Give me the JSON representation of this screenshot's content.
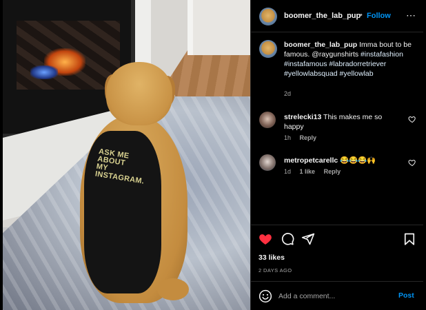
{
  "post": {
    "username": "boomer_the_lab_pup",
    "follow_label": "Follow",
    "separator": "•",
    "more_icon": "more-horizontal-icon",
    "photo": {
      "shirt_text": "ASK ME\nABOUT\nMY\nINSTAGRAM."
    }
  },
  "caption": {
    "username": "boomer_the_lab_pup",
    "text": "Imma bout to be famous. @raygunshirts",
    "hashtags": "#instafashion #instafamous #labradorretriever #yellowlabsquad #yellowlab",
    "time": "2d"
  },
  "comments": [
    {
      "username": "strelecki13",
      "text": "This makes me so happy",
      "time": "1h",
      "likes": "",
      "reply_label": "Reply"
    },
    {
      "username": "metropetcarellc",
      "text": "😂😂😂🙌",
      "time": "1d",
      "likes": "1 like",
      "reply_label": "Reply"
    }
  ],
  "actions": {
    "like_icon": "heart-filled-icon",
    "comment_icon": "comment-icon",
    "share_icon": "share-icon",
    "save_icon": "bookmark-icon",
    "like_color": "#ff3040"
  },
  "likes_count": "33 likes",
  "post_date": "2 DAYS AGO",
  "add_comment": {
    "placeholder": "Add a comment...",
    "post_label": "Post"
  }
}
